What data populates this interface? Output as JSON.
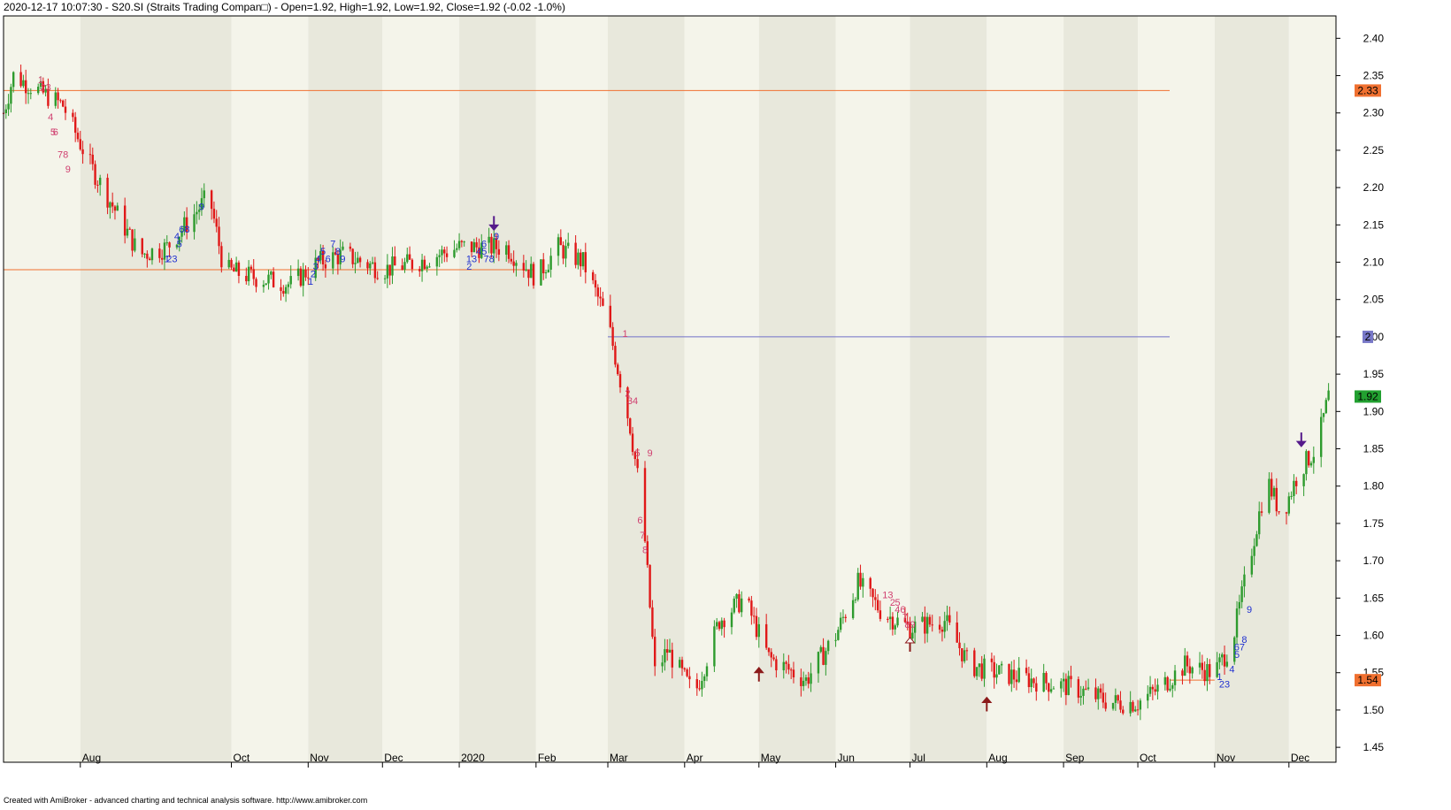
{
  "header": {
    "title": "2020-12-17 10:07:30 - S20.SI (Straits Trading Compan□) -  Open=1.92, High=1.92, Low=1.92, Close=1.92 (-0.02 -1.0%)"
  },
  "footer": {
    "credit": "Created with AmiBroker - advanced charting and technical analysis software. http://www.amibroker.com"
  },
  "colors": {
    "up": "#2e9b2e",
    "down": "#e01818",
    "band_light": "#f4f4ea",
    "band_dark": "#e8e8dc",
    "level_orange": "#f07030",
    "level_blue": "#7070c8",
    "seq_red": "#d04070",
    "seq_blue": "#2030d0",
    "arrow": "#551a8b",
    "arrow_red": "#8b1a1a"
  },
  "chart_data": {
    "type": "candlestick",
    "title": "S20.SI (Straits Trading Compan□)",
    "ylim": [
      1.43,
      2.43
    ],
    "x_domain": [
      "2019-07-01",
      "2020-12-20"
    ],
    "y_ticks": [
      "2.40",
      "2.35",
      "2.30",
      "2.25",
      "2.20",
      "2.15",
      "2.10",
      "2.05",
      "2.00",
      "1.95",
      "1.90",
      "1.85",
      "1.80",
      "1.75",
      "1.70",
      "1.65",
      "1.60",
      "1.55",
      "1.50",
      "1.45"
    ],
    "x_ticks": [
      {
        "date": "2019-08-01",
        "label": "Aug"
      },
      {
        "date": "2019-10-01",
        "label": "Oct"
      },
      {
        "date": "2019-11-01",
        "label": "Nov"
      },
      {
        "date": "2019-12-01",
        "label": "Dec"
      },
      {
        "date": "2020-01-01",
        "label": "2020"
      },
      {
        "date": "2020-02-01",
        "label": "Feb"
      },
      {
        "date": "2020-03-01",
        "label": "Mar"
      },
      {
        "date": "2020-04-01",
        "label": "Apr"
      },
      {
        "date": "2020-05-01",
        "label": "May"
      },
      {
        "date": "2020-06-01",
        "label": "Jun"
      },
      {
        "date": "2020-07-01",
        "label": "Jul"
      },
      {
        "date": "2020-08-01",
        "label": "Aug"
      },
      {
        "date": "2020-09-01",
        "label": "Sep"
      },
      {
        "date": "2020-10-01",
        "label": "Oct"
      },
      {
        "date": "2020-11-01",
        "label": "Nov"
      },
      {
        "date": "2020-12-01",
        "label": "Dec"
      }
    ],
    "price_labels": [
      {
        "value": 2.33,
        "label": "2.33",
        "color": "#f07030"
      },
      {
        "value": 2.0,
        "label": "2",
        "color": "#7878c8"
      },
      {
        "value": 1.92,
        "label": "1.92",
        "color": "#22a030"
      },
      {
        "value": 1.54,
        "label": "1.54",
        "color": "#f07030"
      }
    ],
    "levels": [
      {
        "value": 2.33,
        "from": "2019-07-01",
        "to": "2020-12-20",
        "color": "#f07030"
      },
      {
        "value": 2.09,
        "from": "2019-07-01",
        "to": "2020-01-31",
        "color": "#f07030"
      },
      {
        "value": 2.0,
        "from": "2020-03-01",
        "to": "2020-12-20",
        "color": "#7070c8"
      },
      {
        "value": 1.54,
        "from": "2020-11-01",
        "to": "2020-12-20",
        "color": "#f07030"
      }
    ],
    "keypoints": [
      {
        "date": "2019-07-01",
        "close": 2.3
      },
      {
        "date": "2019-07-05",
        "close": 2.35
      },
      {
        "date": "2019-07-15",
        "close": 2.33
      },
      {
        "date": "2019-07-25",
        "close": 2.31
      },
      {
        "date": "2019-08-05",
        "close": 2.23
      },
      {
        "date": "2019-08-15",
        "close": 2.17
      },
      {
        "date": "2019-08-25",
        "close": 2.11
      },
      {
        "date": "2019-09-05",
        "close": 2.12
      },
      {
        "date": "2019-09-15",
        "close": 2.16
      },
      {
        "date": "2019-09-22",
        "close": 2.19
      },
      {
        "date": "2019-09-28",
        "close": 2.09
      },
      {
        "date": "2019-10-10",
        "close": 2.08
      },
      {
        "date": "2019-10-25",
        "close": 2.07
      },
      {
        "date": "2019-11-05",
        "close": 2.1
      },
      {
        "date": "2019-11-15",
        "close": 2.11
      },
      {
        "date": "2019-12-01",
        "close": 2.09
      },
      {
        "date": "2019-12-15",
        "close": 2.1
      },
      {
        "date": "2020-01-01",
        "close": 2.12
      },
      {
        "date": "2020-01-20",
        "close": 2.12
      },
      {
        "date": "2020-02-01",
        "close": 2.08
      },
      {
        "date": "2020-02-10",
        "close": 2.12
      },
      {
        "date": "2020-02-20",
        "close": 2.1
      },
      {
        "date": "2020-03-01",
        "close": 2.02
      },
      {
        "date": "2020-03-10",
        "close": 1.88
      },
      {
        "date": "2020-03-15",
        "close": 1.77
      },
      {
        "date": "2020-03-20",
        "close": 1.55
      },
      {
        "date": "2020-03-25",
        "close": 1.58
      },
      {
        "date": "2020-04-05",
        "close": 1.52
      },
      {
        "date": "2020-04-15",
        "close": 1.62
      },
      {
        "date": "2020-04-25",
        "close": 1.65
      },
      {
        "date": "2020-05-05",
        "close": 1.57
      },
      {
        "date": "2020-05-20",
        "close": 1.54
      },
      {
        "date": "2020-06-01",
        "close": 1.6
      },
      {
        "date": "2020-06-10",
        "close": 1.67
      },
      {
        "date": "2020-06-20",
        "close": 1.63
      },
      {
        "date": "2020-07-01",
        "close": 1.61
      },
      {
        "date": "2020-07-15",
        "close": 1.62
      },
      {
        "date": "2020-07-25",
        "close": 1.56
      },
      {
        "date": "2020-08-05",
        "close": 1.55
      },
      {
        "date": "2020-08-20",
        "close": 1.54
      },
      {
        "date": "2020-09-05",
        "close": 1.53
      },
      {
        "date": "2020-09-20",
        "close": 1.51
      },
      {
        "date": "2020-10-01",
        "close": 1.51
      },
      {
        "date": "2020-10-10",
        "close": 1.53
      },
      {
        "date": "2020-10-20",
        "close": 1.56
      },
      {
        "date": "2020-11-01",
        "close": 1.55
      },
      {
        "date": "2020-11-08",
        "close": 1.59
      },
      {
        "date": "2020-11-15",
        "close": 1.7
      },
      {
        "date": "2020-11-22",
        "close": 1.81
      },
      {
        "date": "2020-11-28",
        "close": 1.76
      },
      {
        "date": "2020-12-05",
        "close": 1.82
      },
      {
        "date": "2020-12-12",
        "close": 1.85
      },
      {
        "date": "2020-12-17",
        "close": 1.92
      }
    ],
    "sequence_labels": [
      {
        "date": "2019-07-16",
        "value": 2.34,
        "text": "1",
        "color": "#d04070"
      },
      {
        "date": "2019-07-18",
        "value": 2.33,
        "text": "23",
        "color": "#d04070"
      },
      {
        "date": "2019-07-20",
        "value": 2.29,
        "text": "4",
        "color": "#d04070"
      },
      {
        "date": "2019-07-21",
        "value": 2.27,
        "text": "5",
        "color": "#d04070"
      },
      {
        "date": "2019-07-22",
        "value": 2.27,
        "text": "6",
        "color": "#d04070"
      },
      {
        "date": "2019-07-25",
        "value": 2.24,
        "text": "78",
        "color": "#d04070"
      },
      {
        "date": "2019-07-27",
        "value": 2.22,
        "text": "9",
        "color": "#d04070"
      },
      {
        "date": "2019-09-05",
        "value": 2.1,
        "text": "1",
        "color": "#2030d0"
      },
      {
        "date": "2019-09-07",
        "value": 2.1,
        "text": "23",
        "color": "#2030d0"
      },
      {
        "date": "2019-09-09",
        "value": 2.13,
        "text": "4",
        "color": "#2030d0"
      },
      {
        "date": "2019-09-10",
        "value": 2.12,
        "text": "5",
        "color": "#2030d0"
      },
      {
        "date": "2019-09-12",
        "value": 2.14,
        "text": "68",
        "color": "#2030d0"
      },
      {
        "date": "2019-09-19",
        "value": 2.17,
        "text": "9",
        "color": "#2030d0"
      },
      {
        "date": "2019-11-02",
        "value": 2.07,
        "text": "1",
        "color": "#2030d0"
      },
      {
        "date": "2019-11-03",
        "value": 2.08,
        "text": "2",
        "color": "#2030d0"
      },
      {
        "date": "2019-11-04",
        "value": 2.09,
        "text": "3",
        "color": "#2030d0"
      },
      {
        "date": "2019-11-05",
        "value": 2.1,
        "text": "4",
        "color": "#2030d0"
      },
      {
        "date": "2019-11-07",
        "value": 2.11,
        "text": "5",
        "color": "#2030d0"
      },
      {
        "date": "2019-11-09",
        "value": 2.1,
        "text": "6",
        "color": "#2030d0"
      },
      {
        "date": "2019-11-11",
        "value": 2.12,
        "text": "7",
        "color": "#2030d0"
      },
      {
        "date": "2019-11-13",
        "value": 2.11,
        "text": "8",
        "color": "#2030d0"
      },
      {
        "date": "2019-11-15",
        "value": 2.1,
        "text": "9",
        "color": "#2030d0"
      },
      {
        "date": "2020-01-05",
        "value": 2.09,
        "text": "2",
        "color": "#2030d0"
      },
      {
        "date": "2020-01-06",
        "value": 2.1,
        "text": "13",
        "color": "#2030d0"
      },
      {
        "date": "2020-01-10",
        "value": 2.11,
        "text": "45",
        "color": "#2030d0"
      },
      {
        "date": "2020-01-11",
        "value": 2.12,
        "text": "6",
        "color": "#2030d0"
      },
      {
        "date": "2020-01-13",
        "value": 2.1,
        "text": "78",
        "color": "#2030d0"
      },
      {
        "date": "2020-01-16",
        "value": 2.13,
        "text": "9",
        "color": "#2030d0"
      },
      {
        "date": "2020-03-08",
        "value": 2.0,
        "text": "1",
        "color": "#d04070"
      },
      {
        "date": "2020-03-09",
        "value": 1.92,
        "text": "2",
        "color": "#d04070"
      },
      {
        "date": "2020-03-11",
        "value": 1.91,
        "text": "34",
        "color": "#d04070"
      },
      {
        "date": "2020-03-13",
        "value": 1.84,
        "text": "5",
        "color": "#d04070"
      },
      {
        "date": "2020-03-14",
        "value": 1.75,
        "text": "6",
        "color": "#d04070"
      },
      {
        "date": "2020-03-15",
        "value": 1.73,
        "text": "7",
        "color": "#d04070"
      },
      {
        "date": "2020-03-16",
        "value": 1.71,
        "text": "8",
        "color": "#d04070"
      },
      {
        "date": "2020-03-18",
        "value": 1.84,
        "text": "9",
        "color": "#d04070"
      },
      {
        "date": "2020-06-22",
        "value": 1.65,
        "text": "13",
        "color": "#d04070"
      },
      {
        "date": "2020-06-24",
        "value": 1.64,
        "text": "2",
        "color": "#d04070"
      },
      {
        "date": "2020-06-26",
        "value": 1.64,
        "text": "5",
        "color": "#d04070"
      },
      {
        "date": "2020-06-27",
        "value": 1.63,
        "text": "46",
        "color": "#d04070"
      },
      {
        "date": "2020-06-29",
        "value": 1.62,
        "text": "7",
        "color": "#d04070"
      },
      {
        "date": "2020-07-01",
        "value": 1.61,
        "text": "89",
        "color": "#d04070"
      },
      {
        "date": "2020-11-03",
        "value": 1.54,
        "text": "1",
        "color": "#2030d0"
      },
      {
        "date": "2020-11-05",
        "value": 1.53,
        "text": "23",
        "color": "#2030d0"
      },
      {
        "date": "2020-11-08",
        "value": 1.55,
        "text": "4",
        "color": "#2030d0"
      },
      {
        "date": "2020-11-10",
        "value": 1.57,
        "text": "5",
        "color": "#2030d0"
      },
      {
        "date": "2020-11-11",
        "value": 1.58,
        "text": "67",
        "color": "#2030d0"
      },
      {
        "date": "2020-11-13",
        "value": 1.59,
        "text": "8",
        "color": "#2030d0"
      },
      {
        "date": "2020-11-15",
        "value": 1.63,
        "text": "9",
        "color": "#2030d0"
      }
    ],
    "arrows": [
      {
        "date": "2020-01-15",
        "value": 2.15,
        "dir": "down",
        "color": "#551a8b"
      },
      {
        "date": "2020-12-06",
        "value": 1.86,
        "dir": "down",
        "color": "#551a8b"
      },
      {
        "date": "2020-05-01",
        "value": 1.55,
        "dir": "up",
        "color": "#8b1a1a"
      },
      {
        "date": "2020-08-01",
        "value": 1.51,
        "dir": "up",
        "color": "#8b1a1a"
      },
      {
        "date": "2020-07-01",
        "value": 1.59,
        "dir": "up-hollow",
        "color": "#8b1a1a"
      }
    ],
    "grid": false,
    "legend": "none"
  }
}
